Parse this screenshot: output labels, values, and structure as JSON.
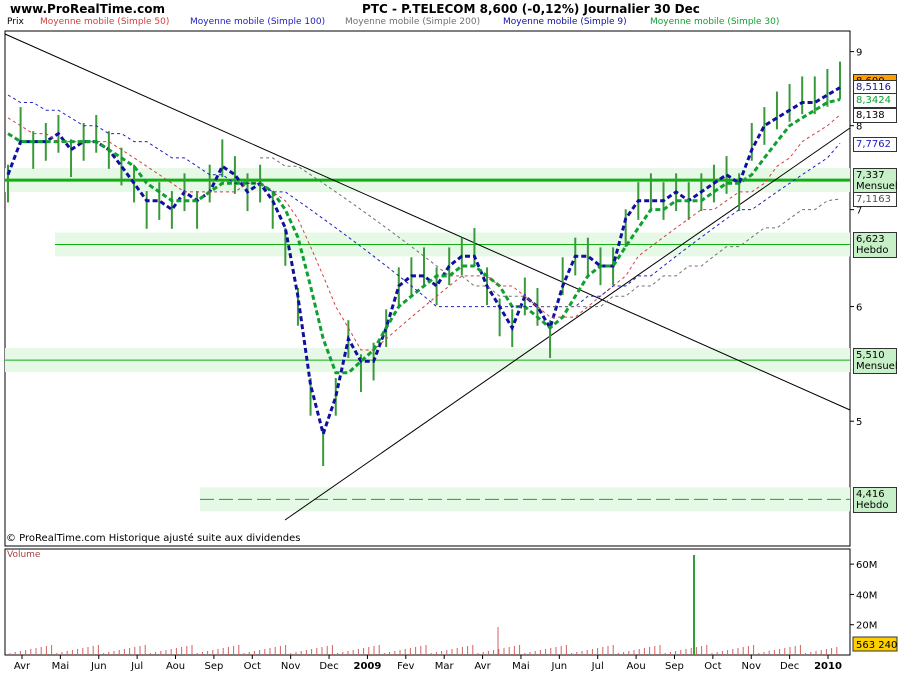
{
  "header": {
    "site": "www.ProRealTime.com",
    "title": "PTC - P.TELECOM    8,600 (-0,12%)    Journalier  30 Dec"
  },
  "legend": [
    {
      "label": "Prix",
      "color": "#000000"
    },
    {
      "label": "Moyenne mobile (Simple 50)",
      "color": "#d04040"
    },
    {
      "label": "Moyenne mobile (Simple 100)",
      "color": "#2020c0"
    },
    {
      "label": "Moyenne mobile (Simple 200)",
      "color": "#707070"
    },
    {
      "label": "Moyenne mobile (Simple 9)",
      "color": "#1010a0"
    },
    {
      "label": "Moyenne mobile (Simple 30)",
      "color": "#10a030"
    }
  ],
  "copyright": "© ProRealTime.com  Historique ajusté suite aux dividendes",
  "volume_label": "Volume",
  "chart_data": {
    "type": "line",
    "price_axis": {
      "ticks": [
        "9",
        "8",
        "7",
        "6",
        "5"
      ],
      "tick_values": [
        9,
        8,
        7,
        6,
        5
      ],
      "scale": "log",
      "range": [
        4.1,
        9.3
      ]
    },
    "x_axis": {
      "labels": [
        "Avr",
        "Mai",
        "Jun",
        "Jul",
        "Aou",
        "Sep",
        "Oct",
        "Nov",
        "Dec",
        "2009",
        "Fev",
        "Mar",
        "Avr",
        "Mai",
        "Jun",
        "Jul",
        "Aou",
        "Sep",
        "Oct",
        "Nov",
        "Dec",
        "2010"
      ]
    },
    "price_tags": [
      {
        "text": "8,600",
        "value": 8.6,
        "bg": "#ffa000",
        "fg": "#000000"
      },
      {
        "text": "8,5116",
        "value": 8.51,
        "bg": "#ffffff",
        "fg": "#1010a0"
      },
      {
        "text": "8,3424",
        "value": 8.34,
        "bg": "#ffffff",
        "fg": "#10a030"
      },
      {
        "text": "8,138",
        "value": 8.138,
        "bg": "#ffffff",
        "fg": "#000000"
      },
      {
        "text": "7,7762",
        "value": 7.78,
        "bg": "#ffffff",
        "fg": "#2020c0"
      },
      {
        "text": "7,337\nMensuel",
        "value": 7.337,
        "bg": "#c8f0c8",
        "fg": "#000000"
      },
      {
        "text": "7,1163",
        "value": 7.12,
        "bg": "#ffffff",
        "fg": "#505050"
      },
      {
        "text": "6,623\nHebdo",
        "value": 6.623,
        "bg": "#c8f0c8",
        "fg": "#000000"
      },
      {
        "text": "5,510\nMensuel",
        "value": 5.51,
        "bg": "#c8f0c8",
        "fg": "#000000"
      },
      {
        "text": "4,416\nHebdo",
        "value": 4.416,
        "bg": "#c8f0c8",
        "fg": "#000000"
      }
    ],
    "support_resistance": [
      {
        "value": 7.337,
        "label": "Mensuel"
      },
      {
        "value": 6.623,
        "label": "Hebdo"
      },
      {
        "value": 5.51,
        "label": "Mensuel"
      },
      {
        "value": 4.416,
        "label": "Hebdo"
      }
    ],
    "volume_axis": {
      "ticks": [
        "60M",
        "40M",
        "20M"
      ],
      "tick_values": [
        60,
        40,
        20
      ],
      "last": "563 240"
    },
    "series": [
      {
        "name": "Prix",
        "color": "#2f8f2f",
        "values": [
          7.3,
          8.0,
          7.7,
          7.8,
          7.9,
          7.6,
          7.8,
          7.9,
          7.7,
          7.5,
          7.3,
          7.0,
          7.1,
          7.0,
          7.2,
          7.0,
          7.3,
          7.6,
          7.4,
          7.2,
          7.3,
          7.0,
          6.6,
          6.0,
          5.2,
          4.8,
          5.2,
          5.7,
          5.4,
          5.5,
          5.8,
          6.2,
          6.3,
          6.4,
          6.2,
          6.4,
          6.5,
          6.6,
          6.2,
          5.9,
          5.8,
          6.1,
          6.0,
          5.7,
          6.3,
          6.5,
          6.5,
          6.4,
          6.4,
          6.8,
          7.1,
          7.2,
          7.1,
          7.2,
          7.1,
          7.2,
          7.3,
          7.4,
          7.2,
          7.8,
          8.0,
          8.2,
          8.3,
          8.4,
          8.4,
          8.5,
          8.6
        ]
      },
      {
        "name": "Moyenne mobile (Simple 9)",
        "color": "#1010a0",
        "values": [
          7.4,
          7.8,
          7.8,
          7.8,
          7.9,
          7.7,
          7.8,
          7.8,
          7.7,
          7.5,
          7.3,
          7.1,
          7.1,
          7.0,
          7.2,
          7.1,
          7.2,
          7.5,
          7.4,
          7.2,
          7.3,
          7.1,
          6.8,
          6.1,
          5.3,
          4.9,
          5.2,
          5.7,
          5.5,
          5.5,
          5.8,
          6.2,
          6.3,
          6.3,
          6.2,
          6.4,
          6.5,
          6.5,
          6.2,
          6.0,
          5.8,
          6.1,
          6.0,
          5.8,
          6.2,
          6.5,
          6.5,
          6.4,
          6.4,
          6.9,
          7.1,
          7.1,
          7.1,
          7.2,
          7.1,
          7.2,
          7.3,
          7.4,
          7.3,
          7.7,
          8.0,
          8.1,
          8.2,
          8.3,
          8.3,
          8.4,
          8.5
        ]
      },
      {
        "name": "Moyenne mobile (Simple 30)",
        "color": "#10a030",
        "values": [
          7.9,
          7.8,
          7.8,
          7.8,
          7.8,
          7.8,
          7.8,
          7.8,
          7.7,
          7.6,
          7.5,
          7.3,
          7.2,
          7.1,
          7.1,
          7.1,
          7.2,
          7.3,
          7.3,
          7.3,
          7.3,
          7.2,
          7.0,
          6.7,
          6.2,
          5.7,
          5.4,
          5.4,
          5.5,
          5.6,
          5.8,
          6.0,
          6.1,
          6.2,
          6.3,
          6.3,
          6.4,
          6.4,
          6.3,
          6.2,
          6.0,
          6.0,
          5.9,
          5.8,
          5.9,
          6.1,
          6.3,
          6.4,
          6.4,
          6.6,
          6.8,
          7.0,
          7.0,
          7.1,
          7.1,
          7.1,
          7.2,
          7.3,
          7.3,
          7.4,
          7.6,
          7.8,
          8.0,
          8.1,
          8.2,
          8.3,
          8.34
        ]
      },
      {
        "name": "Moyenne mobile (Simple 50)",
        "color": "#d04040",
        "values": [
          8.1,
          8.0,
          7.9,
          7.9,
          7.8,
          7.8,
          7.8,
          7.8,
          7.8,
          7.7,
          7.6,
          7.5,
          7.4,
          7.3,
          7.2,
          7.2,
          7.2,
          7.2,
          7.2,
          7.3,
          7.3,
          7.2,
          7.1,
          6.9,
          6.6,
          6.3,
          6.0,
          5.8,
          5.6,
          5.6,
          5.7,
          5.8,
          5.9,
          6.0,
          6.1,
          6.2,
          6.3,
          6.3,
          6.3,
          6.2,
          6.2,
          6.1,
          6.0,
          5.9,
          5.9,
          5.9,
          6.0,
          6.1,
          6.2,
          6.3,
          6.5,
          6.6,
          6.7,
          6.8,
          6.9,
          7.0,
          7.0,
          7.1,
          7.2,
          7.2,
          7.3,
          7.5,
          7.6,
          7.8,
          7.9,
          8.0,
          8.14
        ]
      },
      {
        "name": "Moyenne mobile (Simple 100)",
        "color": "#2020c0",
        "values": [
          8.4,
          8.3,
          8.3,
          8.2,
          8.2,
          8.1,
          8.0,
          8.0,
          7.9,
          7.9,
          7.8,
          7.8,
          7.7,
          7.6,
          7.6,
          7.5,
          7.4,
          7.4,
          7.3,
          7.3,
          7.3,
          7.2,
          7.2,
          7.1,
          7.0,
          6.9,
          6.8,
          6.7,
          6.6,
          6.5,
          6.4,
          6.3,
          6.2,
          6.1,
          6.0,
          6.0,
          6.0,
          6.0,
          6.0,
          6.0,
          6.0,
          6.0,
          6.0,
          6.0,
          6.0,
          6.0,
          6.1,
          6.1,
          6.2,
          6.2,
          6.3,
          6.3,
          6.4,
          6.5,
          6.6,
          6.7,
          6.8,
          6.9,
          7.0,
          7.0,
          7.1,
          7.2,
          7.3,
          7.4,
          7.5,
          7.6,
          7.78
        ]
      },
      {
        "name": "Moyenne mobile (Simple 200)",
        "color": "#707070",
        "values": [
          null,
          null,
          null,
          null,
          null,
          null,
          null,
          null,
          null,
          null,
          null,
          null,
          null,
          null,
          null,
          null,
          null,
          null,
          null,
          null,
          7.6,
          7.6,
          7.5,
          7.5,
          7.4,
          7.3,
          7.2,
          7.1,
          7.0,
          6.9,
          6.8,
          6.7,
          6.6,
          6.5,
          6.4,
          6.3,
          6.3,
          6.2,
          6.2,
          6.1,
          6.1,
          6.1,
          6.0,
          6.0,
          6.0,
          6.0,
          6.0,
          6.0,
          6.1,
          6.1,
          6.2,
          6.2,
          6.3,
          6.3,
          6.4,
          6.4,
          6.5,
          6.6,
          6.6,
          6.7,
          6.8,
          6.8,
          6.9,
          7.0,
          7.0,
          7.1,
          7.12
        ]
      }
    ]
  }
}
